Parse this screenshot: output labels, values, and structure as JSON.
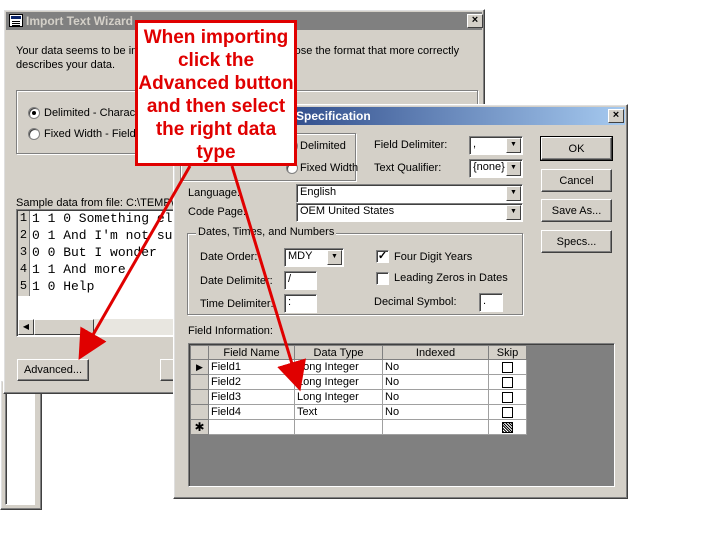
{
  "wizard": {
    "title": "Import Text Wizard",
    "description": "Your data seems to be in a delimited format. If it isn't, choose the format that more correctly describes your data.",
    "radio_delimited": "Delimited - Characters such as comma or tab separate each field",
    "radio_fixed": "Fixed Width - Fields are aligned in columns with spaces between each field",
    "sample_label": "Sample data from file: C:\\TEMP\\TrueFalse.txt",
    "sample_rows": [
      {
        "num": "1",
        "text": "1 1 0 Something else"
      },
      {
        "num": "2",
        "text": "0 1 And I'm not sure"
      },
      {
        "num": "3",
        "text": "0 0 But I wonder"
      },
      {
        "num": "4",
        "text": "1 1 And more"
      },
      {
        "num": "5",
        "text": "1 0 Help"
      }
    ],
    "advanced_button": "Advanced..."
  },
  "spec": {
    "title": "TrueFalse Import Specification",
    "format_delimited": "Delimited",
    "format_fixed": "Fixed Width",
    "field_delimiter_label": "Field Delimiter:",
    "field_delimiter_value": ",",
    "text_qualifier_label": "Text Qualifier:",
    "text_qualifier_value": "{none}",
    "ok_button": "OK",
    "cancel_button": "Cancel",
    "save_as_button": "Save As...",
    "specs_button": "Specs...",
    "language_label": "Language:",
    "language_value": "English",
    "code_page_label": "Code Page:",
    "code_page_value": "OEM United States",
    "dates_group_label": "Dates, Times, and Numbers",
    "date_order_label": "Date Order:",
    "date_order_value": "MDY",
    "four_digit_years_label": "Four Digit Years",
    "date_delimiter_label": "Date Delimiter:",
    "date_delimiter_value": "/",
    "leading_zeros_label": "Leading Zeros in Dates",
    "time_delimiter_label": "Time Delimiter:",
    "time_delimiter_value": ":",
    "decimal_symbol_label": "Decimal Symbol:",
    "decimal_symbol_value": ".",
    "field_info_label": "Field Information:",
    "columns": [
      "Field Name",
      "Data Type",
      "Indexed",
      "Skip"
    ],
    "fields": [
      {
        "name": "Field1",
        "type": "Long Integer",
        "indexed": "No"
      },
      {
        "name": "Field2",
        "type": "Long Integer",
        "indexed": "No"
      },
      {
        "name": "Field3",
        "type": "Long Integer",
        "indexed": "No"
      },
      {
        "name": "Field4",
        "type": "Text",
        "indexed": "No"
      }
    ]
  },
  "callout": {
    "text": "When importing click the Advanced button and then select the right data type",
    "color": "#e00000"
  },
  "colors": {
    "dialog_face": "#d4d0c8",
    "active_title": "#0a246a",
    "inactive_title": "#808080"
  }
}
